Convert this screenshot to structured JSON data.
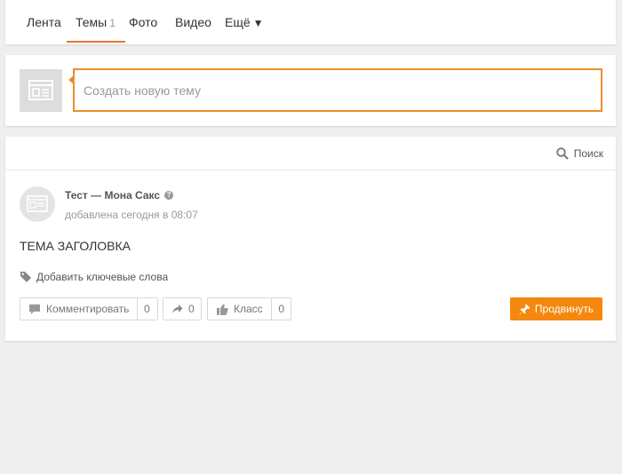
{
  "tabs": {
    "items": [
      {
        "label": "Лента"
      },
      {
        "label": "Темы",
        "count": "1"
      },
      {
        "label": "Фото"
      },
      {
        "label": "Видео"
      },
      {
        "label": "Ещё",
        "icon": "triangle-down-icon"
      }
    ],
    "active": "Темы",
    "accent_color": "#eb722e"
  },
  "new_topic": {
    "placeholder": "Создать новую тему",
    "border_color": "#eb8d2e"
  },
  "feed": {
    "search_label": "Поиск",
    "post": {
      "title": "Тест — Мона Сакс",
      "meta": "добавлена сегодня в 08:07",
      "text": "ТЕМА ЗАГОЛОВКА",
      "add_tags_label": "Добавить ключевые слова",
      "actions": {
        "comment_label": "Комментировать",
        "comment_count": "0",
        "share_count": "0",
        "class_label": "Класс",
        "class_count": "0"
      },
      "promote_label": "Продвинуть",
      "promote_color": "#f4880e"
    }
  }
}
